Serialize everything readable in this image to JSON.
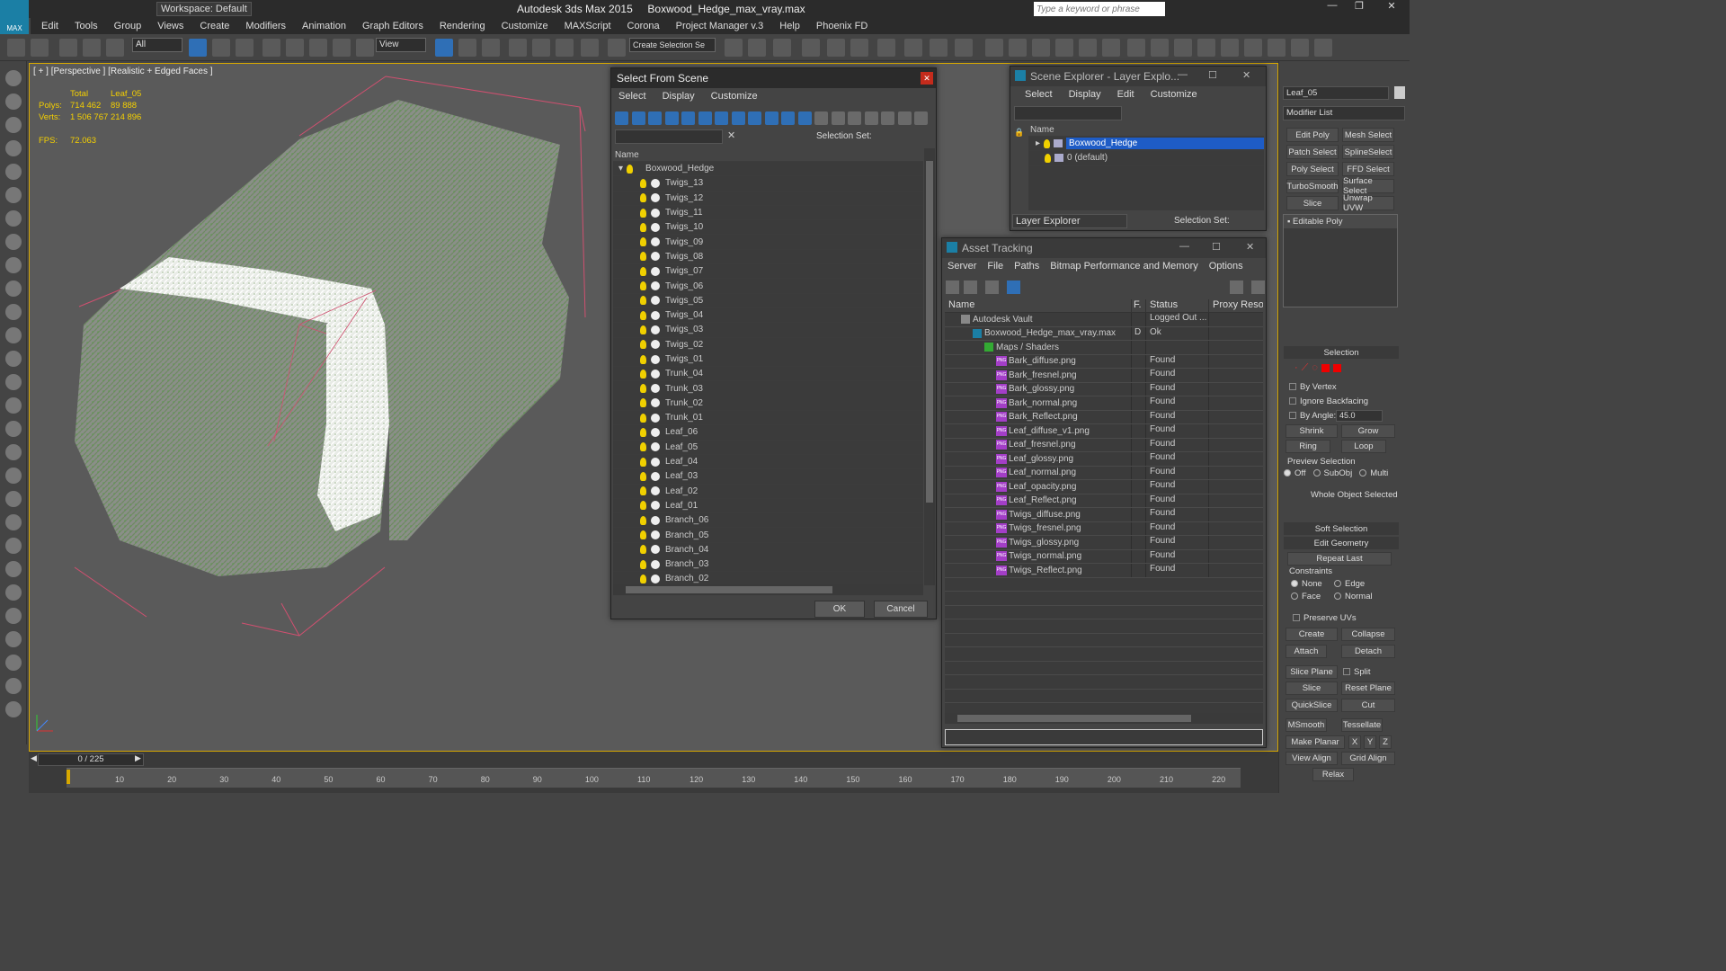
{
  "app": {
    "title": "Autodesk 3ds Max  2015",
    "file": "Boxwood_Hedge_max_vray.max",
    "workspace": "Workspace: Default",
    "search_placeholder": "Type a keyword or phrase",
    "logo": "MAX"
  },
  "menu": [
    "Edit",
    "Tools",
    "Group",
    "Views",
    "Create",
    "Modifiers",
    "Animation",
    "Graph Editors",
    "Rendering",
    "Customize",
    "MAXScript",
    "Corona",
    "Project Manager v.3",
    "Help",
    "Phoenix FD"
  ],
  "toolbar": {
    "filter": "All",
    "ref_coord": "View",
    "selection_set": "Create Selection Se"
  },
  "viewport": {
    "label": "[ + ] [Perspective ] [Realistic + Edged Faces ]",
    "stats": {
      "total_label": "Total",
      "obj_label": "Leaf_05",
      "polys_label": "Polys:",
      "polys_total": "714 462",
      "polys_obj": "89 888",
      "verts_label": "Verts:",
      "verts_total": "1 506 767",
      "verts_obj": "214 896",
      "fps_label": "FPS:",
      "fps": "72.063"
    }
  },
  "timeline": {
    "frame": "0 / 225",
    "ticks": [
      "10",
      "20",
      "30",
      "40",
      "50",
      "60",
      "70",
      "80",
      "90",
      "100",
      "110",
      "120",
      "130",
      "140",
      "150",
      "160",
      "170",
      "180",
      "190",
      "200",
      "210",
      "220"
    ]
  },
  "select_dialog": {
    "title": "Select From Scene",
    "menu": [
      "Select",
      "Display",
      "Customize"
    ],
    "selection_set_label": "Selection Set:",
    "column_name": "Name",
    "root": "Boxwood_Hedge",
    "items": [
      "Twigs_13",
      "Twigs_12",
      "Twigs_11",
      "Twigs_10",
      "Twigs_09",
      "Twigs_08",
      "Twigs_07",
      "Twigs_06",
      "Twigs_05",
      "Twigs_04",
      "Twigs_03",
      "Twigs_02",
      "Twigs_01",
      "Trunk_04",
      "Trunk_03",
      "Trunk_02",
      "Trunk_01",
      "Leaf_06",
      "Leaf_05",
      "Leaf_04",
      "Leaf_03",
      "Leaf_02",
      "Leaf_01",
      "Branch_06",
      "Branch_05",
      "Branch_04",
      "Branch_03",
      "Branch_02"
    ],
    "ok": "OK",
    "cancel": "Cancel"
  },
  "scene_explorer": {
    "title": "Scene Explorer - Layer Explo...",
    "menu": [
      "Select",
      "Display",
      "Edit",
      "Customize"
    ],
    "column_name": "Name",
    "rows": [
      "Boxwood_Hedge",
      "0 (default)"
    ],
    "footer_dropdown": "Layer Explorer",
    "selection_set_label": "Selection Set:"
  },
  "asset_tracking": {
    "title": "Asset Tracking",
    "menu": [
      "Server",
      "File",
      "Paths",
      "Bitmap Performance and Memory",
      "Options"
    ],
    "columns": [
      "Name",
      "F.",
      "Status",
      "Proxy Resol."
    ],
    "rows": [
      {
        "name": "Autodesk Vault",
        "flag": "",
        "status": "Logged Out ...",
        "level": 0,
        "icon": "vault"
      },
      {
        "name": "Boxwood_Hedge_max_vray.max",
        "flag": "D",
        "status": "Ok",
        "level": 1,
        "icon": "max"
      },
      {
        "name": "Maps / Shaders",
        "flag": "",
        "status": "",
        "level": 2,
        "icon": "folder"
      },
      {
        "name": "Bark_diffuse.png",
        "flag": "",
        "status": "Found",
        "level": 3,
        "icon": "png"
      },
      {
        "name": "Bark_fresnel.png",
        "flag": "",
        "status": "Found",
        "level": 3,
        "icon": "png"
      },
      {
        "name": "Bark_glossy.png",
        "flag": "",
        "status": "Found",
        "level": 3,
        "icon": "png"
      },
      {
        "name": "Bark_normal.png",
        "flag": "",
        "status": "Found",
        "level": 3,
        "icon": "png"
      },
      {
        "name": "Bark_Reflect.png",
        "flag": "",
        "status": "Found",
        "level": 3,
        "icon": "png"
      },
      {
        "name": "Leaf_diffuse_v1.png",
        "flag": "",
        "status": "Found",
        "level": 3,
        "icon": "png"
      },
      {
        "name": "Leaf_fresnel.png",
        "flag": "",
        "status": "Found",
        "level": 3,
        "icon": "png"
      },
      {
        "name": "Leaf_glossy.png",
        "flag": "",
        "status": "Found",
        "level": 3,
        "icon": "png"
      },
      {
        "name": "Leaf_normal.png",
        "flag": "",
        "status": "Found",
        "level": 3,
        "icon": "png"
      },
      {
        "name": "Leaf_opacity.png",
        "flag": "",
        "status": "Found",
        "level": 3,
        "icon": "png"
      },
      {
        "name": "Leaf_Reflect.png",
        "flag": "",
        "status": "Found",
        "level": 3,
        "icon": "png"
      },
      {
        "name": "Twigs_diffuse.png",
        "flag": "",
        "status": "Found",
        "level": 3,
        "icon": "png"
      },
      {
        "name": "Twigs_fresnel.png",
        "flag": "",
        "status": "Found",
        "level": 3,
        "icon": "png"
      },
      {
        "name": "Twigs_glossy.png",
        "flag": "",
        "status": "Found",
        "level": 3,
        "icon": "png"
      },
      {
        "name": "Twigs_normal.png",
        "flag": "",
        "status": "Found",
        "level": 3,
        "icon": "png"
      },
      {
        "name": "Twigs_Reflect.png",
        "flag": "",
        "status": "Found",
        "level": 3,
        "icon": "png"
      }
    ],
    "png_badge": "PNG"
  },
  "command_panel": {
    "object_name": "Leaf_05",
    "modifier_list": "Modifier List",
    "modifier_buttons": [
      "Edit Poly",
      "Mesh Select",
      "Patch Select",
      "SplineSelect",
      "Poly Select",
      "FFD Select",
      "TurboSmooth",
      "Surface Select",
      "Slice",
      "Unwrap UVW"
    ],
    "stack_item": "Editable Poly",
    "selection_title": "Selection",
    "by_vertex": "By Vertex",
    "ignore_backfacing": "Ignore Backfacing",
    "by_angle": "By Angle:",
    "angle_value": "45.0",
    "shrink": "Shrink",
    "grow": "Grow",
    "ring": "Ring",
    "loop": "Loop",
    "preview_selection": "Preview Selection",
    "preview_off": "Off",
    "preview_subobj": "SubObj",
    "preview_multi": "Multi",
    "whole_object": "Whole Object Selected",
    "soft_selection": "Soft Selection",
    "edit_geometry": "Edit Geometry",
    "repeat_last": "Repeat Last",
    "constraints": "Constraints",
    "c_none": "None",
    "c_edge": "Edge",
    "c_face": "Face",
    "c_normal": "Normal",
    "preserve_uvs": "Preserve UVs",
    "create": "Create",
    "collapse": "Collapse",
    "attach": "Attach",
    "detach": "Detach",
    "slice_plane": "Slice Plane",
    "split": "Split",
    "slice": "Slice",
    "reset_plane": "Reset Plane",
    "quickslice": "QuickSlice",
    "cut": "Cut",
    "msmooth": "MSmooth",
    "tessellate": "Tessellate",
    "make_planar": "Make Planar",
    "x": "X",
    "y": "Y",
    "z": "Z",
    "view_align": "View Align",
    "grid_align": "Grid Align",
    "relax": "Relax"
  },
  "colors": {
    "accent": "#1e5cc6",
    "bulb": "#f0d000",
    "bbox": "#d05070",
    "png": "#a33ec7",
    "hedge": "#7a9a70"
  }
}
